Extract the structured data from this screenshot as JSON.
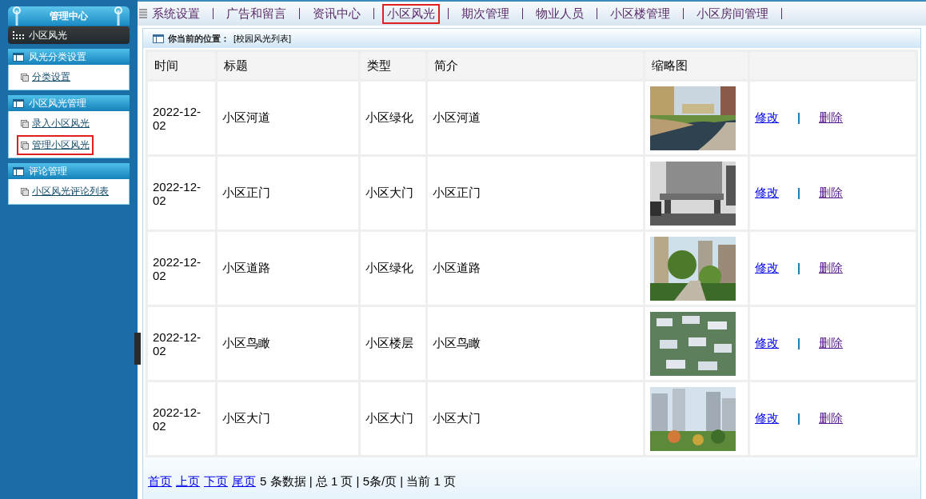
{
  "sidebar": {
    "title": "管理中心",
    "current": "小区风光",
    "groups": [
      {
        "title": "风光分类设置",
        "items": [
          {
            "label": "分类设置",
            "selected": false
          }
        ]
      },
      {
        "title": "小区风光管理",
        "items": [
          {
            "label": "录入小区风光",
            "selected": false
          },
          {
            "label": "管理小区风光",
            "selected": true
          }
        ]
      },
      {
        "title": "评论管理",
        "items": [
          {
            "label": "小区风光评论列表",
            "selected": false
          }
        ]
      }
    ]
  },
  "nav": {
    "items": [
      {
        "label": "系统设置",
        "selected": false
      },
      {
        "label": "广告和留言",
        "selected": false
      },
      {
        "label": "资讯中心",
        "selected": false
      },
      {
        "label": "小区风光",
        "selected": true
      },
      {
        "label": "期次管理",
        "selected": false
      },
      {
        "label": "物业人员",
        "selected": false
      },
      {
        "label": "小区楼管理",
        "selected": false
      },
      {
        "label": "小区房间管理",
        "selected": false
      }
    ]
  },
  "breadcrumb": {
    "label": "你当前的位置：",
    "path": "[校园风光列表]"
  },
  "table": {
    "columns": [
      "时间",
      "标题",
      "类型",
      "简介",
      "缩略图"
    ],
    "rows": [
      {
        "time": "2022-12-02",
        "title": "小区河道",
        "type": "小区绿化",
        "intro": "小区河道",
        "edit": "修改",
        "delete": "删除"
      },
      {
        "time": "2022-12-02",
        "title": "小区正门",
        "type": "小区大门",
        "intro": "小区正门",
        "edit": "修改",
        "delete": "删除"
      },
      {
        "time": "2022-12-02",
        "title": "小区道路",
        "type": "小区绿化",
        "intro": "小区道路",
        "edit": "修改",
        "delete": "删除"
      },
      {
        "time": "2022-12-02",
        "title": "小区鸟瞰",
        "type": "小区楼层",
        "intro": "小区鸟瞰",
        "edit": "修改",
        "delete": "删除"
      },
      {
        "time": "2022-12-02",
        "title": "小区大门",
        "type": "小区大门",
        "intro": "小区大门",
        "edit": "修改",
        "delete": "删除"
      }
    ]
  },
  "pager": {
    "links": [
      "首页",
      "上页",
      "下页",
      "尾页"
    ],
    "info": "5 条数据 | 总 1 页 | 5条/页 | 当前 1 页"
  }
}
